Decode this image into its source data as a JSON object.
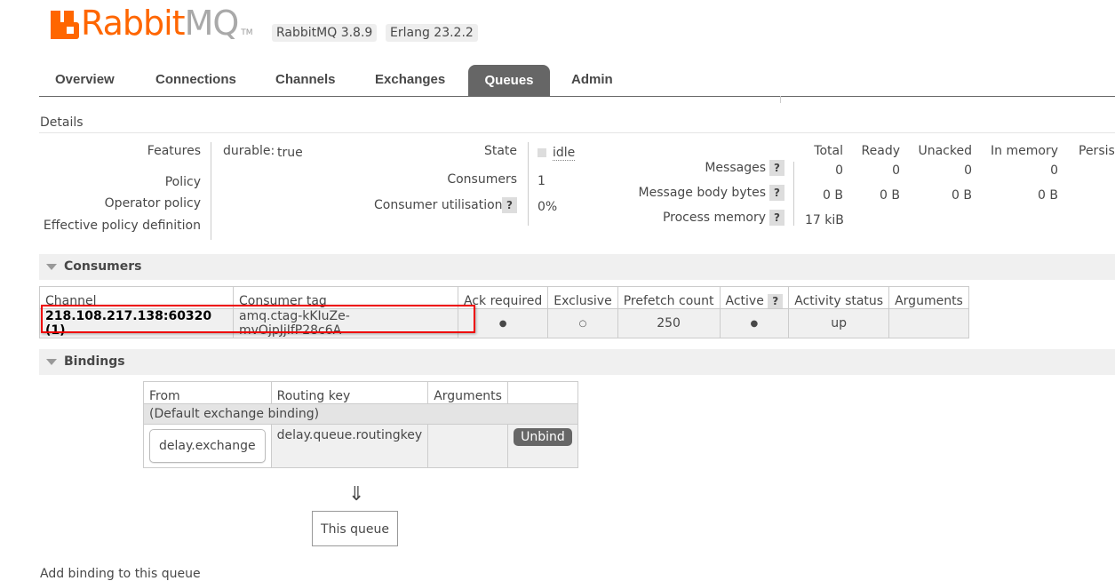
{
  "header": {
    "logo_rabbit": "Rabbit",
    "logo_mq": "MQ",
    "logo_tm": "TM",
    "rabbitmq_version": "RabbitMQ 3.8.9",
    "erlang_version": "Erlang 23.2.2"
  },
  "tabs": [
    {
      "label": "Overview",
      "active": false
    },
    {
      "label": "Connections",
      "active": false
    },
    {
      "label": "Channels",
      "active": false
    },
    {
      "label": "Exchanges",
      "active": false
    },
    {
      "label": "Queues",
      "active": true
    },
    {
      "label": "Admin",
      "active": false
    }
  ],
  "details": {
    "label": "Details",
    "features_label": "Features",
    "features_key": "durable:",
    "features_value": "true",
    "policy_label": "Policy",
    "operator_policy_label": "Operator policy",
    "effective_policy_label": "Effective policy definition",
    "state_label": "State",
    "state_value": "idle",
    "consumers_label": "Consumers",
    "consumers_value": "1",
    "consumer_util_label": "Consumer utilisation",
    "consumer_util_value": "0%",
    "help": "?"
  },
  "stats": {
    "headers": [
      "Total",
      "Ready",
      "Unacked",
      "In memory",
      "Persist"
    ],
    "messages_label": "Messages",
    "messages_values": [
      "0",
      "0",
      "0",
      "0"
    ],
    "body_bytes_label": "Message body bytes",
    "body_bytes_values": [
      "0 B",
      "0 B",
      "0 B",
      "0 B"
    ],
    "process_memory_label": "Process memory",
    "process_memory_value": "17 kiB"
  },
  "consumers": {
    "section_title": "Consumers",
    "headers": [
      "Channel",
      "Consumer tag",
      "Ack required",
      "Exclusive",
      "Prefetch count",
      "Active",
      "Activity status",
      "Arguments"
    ],
    "rows": [
      {
        "channel": "218.108.217.138:60320 (1)",
        "consumer_tag": "amq.ctag-kKIuZe-mvOjpJjIfP28c6A",
        "ack_required": "●",
        "exclusive": "○",
        "prefetch_count": "250",
        "active": "●",
        "activity_status": "up",
        "arguments": ""
      }
    ]
  },
  "bindings": {
    "section_title": "Bindings",
    "headers": [
      "From",
      "Routing key",
      "Arguments",
      ""
    ],
    "default_binding": "(Default exchange binding)",
    "rows": [
      {
        "from": "delay.exchange",
        "routing_key": "delay.queue.routingkey",
        "arguments": "",
        "action": "Unbind"
      }
    ],
    "arrow": "⇓",
    "this_queue": "This queue"
  },
  "footer": {
    "add_binding_text": "Add binding to this queue"
  }
}
